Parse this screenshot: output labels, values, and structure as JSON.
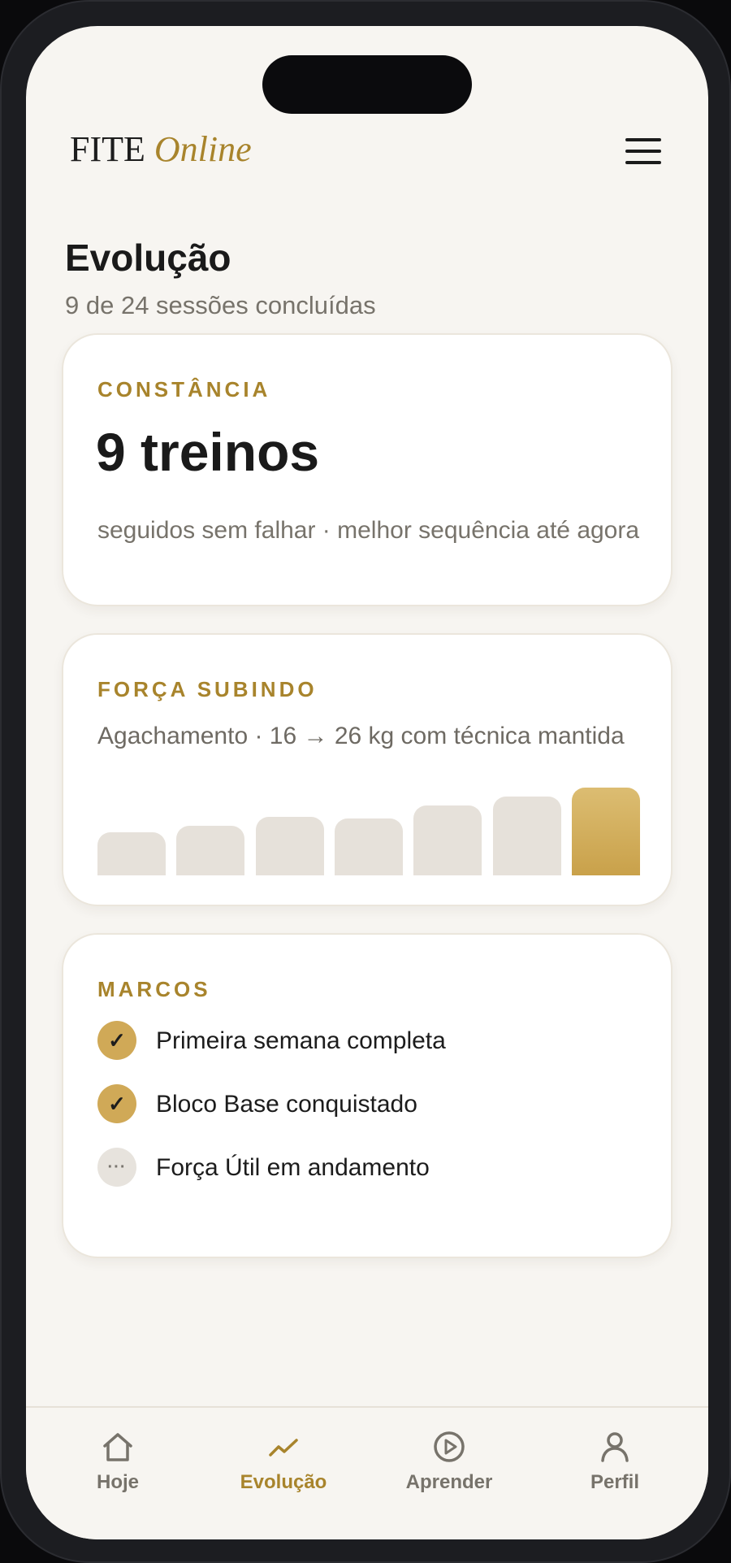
{
  "header": {
    "brand_primary": "FITE",
    "brand_accent": "Online"
  },
  "page": {
    "title": "Evolução",
    "subtitle": "9 de 24 sessões concluídas"
  },
  "consistency_card": {
    "eyebrow": "CONSTÂNCIA",
    "value": "9 treinos",
    "caption": "seguidos sem falhar · melhor sequência até agora"
  },
  "strength_card": {
    "eyebrow": "FORÇA SUBINDO",
    "description": "Agachamento · 16 → 26 kg com técnica mantida"
  },
  "chart_data": {
    "type": "bar",
    "categories": [],
    "values": [
      16,
      17.5,
      19.5,
      19,
      22,
      24,
      26
    ],
    "highlight_index": 6
  },
  "milestones_card": {
    "eyebrow": "MARCOS",
    "items": [
      {
        "label": "Primeira semana completa",
        "status": "done",
        "icon": "✓"
      },
      {
        "label": "Bloco Base conquistado",
        "status": "done",
        "icon": "✓"
      },
      {
        "label": "Força Útil em andamento",
        "status": "pending",
        "icon": "···"
      }
    ]
  },
  "tabbar": {
    "tabs": [
      {
        "label": "Hoje",
        "icon": "home-icon"
      },
      {
        "label": "Evolução",
        "icon": "trend-icon",
        "active": true
      },
      {
        "label": "Aprender",
        "icon": "play-icon"
      },
      {
        "label": "Perfil",
        "icon": "user-icon"
      }
    ]
  },
  "colors": {
    "accent": "#a8842c",
    "accent_fill": "#d0a957",
    "background": "#f7f5f1",
    "muted_bar": "#e6e1da"
  }
}
